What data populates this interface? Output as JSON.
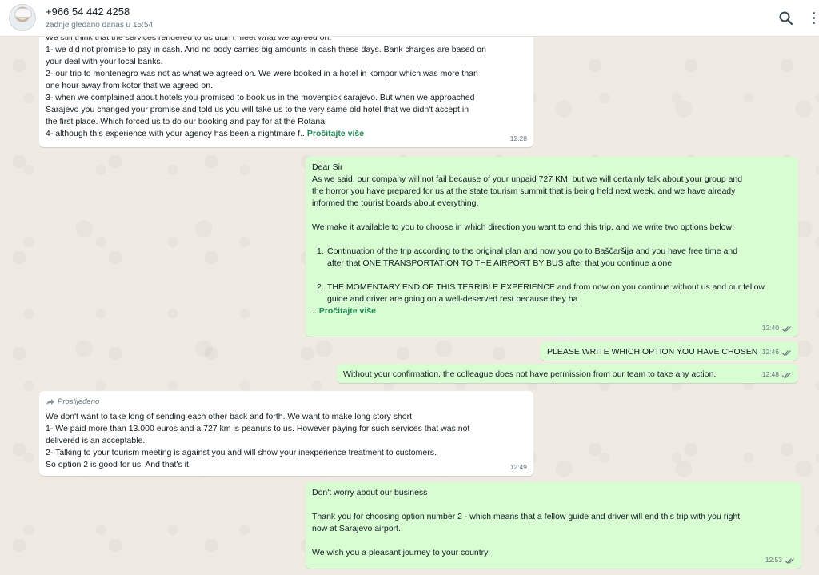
{
  "header": {
    "contact_name": "+966 54 442 4258",
    "status": "zadnje gledano danas u 15:54"
  },
  "messages": {
    "m1": {
      "clipped": "We still think that the services rendered to us didn't meet what we agreed on.",
      "lines": [
        "1- we did not promise to pay in cash. And no body carries big amounts in cash these days. Bank charges are based on",
        "your deal with your local banks.",
        "2- our trip to montenegro was not as what we agreed on. We were booked in a hotel in kompor which was more than",
        "one hour away from kotor that we agreed on.",
        "3- when we complained about hotels you promised to book us in the movenpick sarajevo. But when we approached",
        "Sarajevo you changed your promise and told us you will take us to the very same old hotel that we didn't accept in",
        "the first place. Which forced us to do our booking and pay for at the Rotana."
      ],
      "last_line": "4- although this experience with your agency has been a nightmare f...",
      "read_more": "Pročitajte više",
      "time": "12:28"
    },
    "m2": {
      "greeting": "Dear Sir",
      "para1": [
        "As we said, our company will not fail because of your unpaid 727 KM, but we will certainly talk about your group and",
        "the horror you have prepared for us at the state tourism summit that is being held next week, and we have already",
        "informed the tourist boards about everything."
      ],
      "para2": "We make it available to you to choose in which direction you want to end this trip, and we write two options below:",
      "opt1_num": "1.",
      "opt1": [
        "Continuation of the trip according to the original plan and now you go to Baščaršija and you have free time and",
        "after that ONE TRANSPORTATION TO THE AIRPORT BY BUS after that you continue alone"
      ],
      "opt2_num": "2.",
      "opt2": [
        "THE MOMENTARY END OF THIS TERRIBLE EXPERIENCE and from now on you continue without us and our fellow",
        "guide and driver are going on a well-deserved rest because they ha"
      ],
      "ellipsis": "...",
      "read_more": "Pročitajte više",
      "time": "12:40"
    },
    "m3": {
      "text": "PLEASE WRITE WHICH OPTION YOU HAVE CHOSEN",
      "time": "12:46"
    },
    "m4": {
      "text": "Without your confirmation, the colleague does not have permission from our team to take any action.",
      "time": "12:48"
    },
    "m5": {
      "forwarded": "Proslijeđeno",
      "lines": [
        "We don't want to take long of sending each other back and forth. We want to make long story short.",
        "1- We paid more than 13.000 euros and a 727 km is peanuts to us. However paying for such services that was not",
        "delivered is an acceptable.",
        "2- Talking to your tourism meeting is against you and will show your inexperience treatment to customers.",
        "So option 2 is good for us. And that's it."
      ],
      "time": "12:49"
    },
    "m6": {
      "line1": "Don't worry about our business",
      "para": [
        "Thank you for choosing option number 2 - which means that a fellow guide and driver will end this trip with you right",
        "now at Sarajevo airport."
      ],
      "line_last": "We wish you a pleasant journey to your country",
      "time": "12:53"
    }
  },
  "colors": {
    "incoming": "#ffffff",
    "outgoing": "#d9fdd3",
    "read_tick": "#667781",
    "link": "#1f8a55",
    "chat_bg": "#efeae2"
  },
  "icons": [
    "search-icon",
    "menu-icon",
    "double-check-icon",
    "forward-icon"
  ]
}
